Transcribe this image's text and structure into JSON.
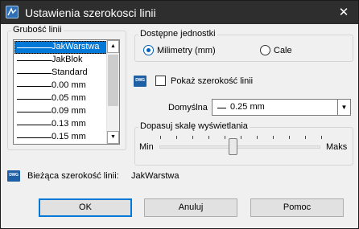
{
  "window": {
    "title": "Ustawienia szerokosci linii",
    "close_glyph": "✕"
  },
  "line_weights": {
    "label": "Grubość linii",
    "selected_value": "JakWarstwa",
    "items": [
      {
        "label": "JakWarstwa"
      },
      {
        "label": "JakBlok"
      },
      {
        "label": "Standard"
      },
      {
        "label": "0.00 mm"
      },
      {
        "label": "0.05 mm"
      },
      {
        "label": "0.09 mm"
      },
      {
        "label": "0.13 mm"
      },
      {
        "label": "0.15 mm"
      }
    ]
  },
  "units": {
    "label": "Dostępne jednostki",
    "options": [
      {
        "label": "Milimetry (mm)",
        "selected": true
      },
      {
        "label": "Cale",
        "selected": false
      }
    ]
  },
  "display": {
    "show_weight_label": "Pokaż szerokość linii",
    "show_weight_checked": false,
    "default_label": "Domyślna",
    "default_value": "0.25 mm",
    "dwg_icon_text": "DWG"
  },
  "scale": {
    "label": "Dopasuj skalę wyświetlania",
    "min_label": "Min",
    "max_label": "Maks",
    "tick_count": 10,
    "value_fraction": 0.45
  },
  "current": {
    "label": "Bieżąca szerokość linii:",
    "value": "JakWarstwa"
  },
  "buttons": {
    "ok": "OK",
    "cancel": "Anuluj",
    "help": "Pomoc"
  },
  "colors": {
    "accent": "#0078d7",
    "titlebar": "#2e2e2e",
    "dwg_icon": "#1f5fa6"
  }
}
